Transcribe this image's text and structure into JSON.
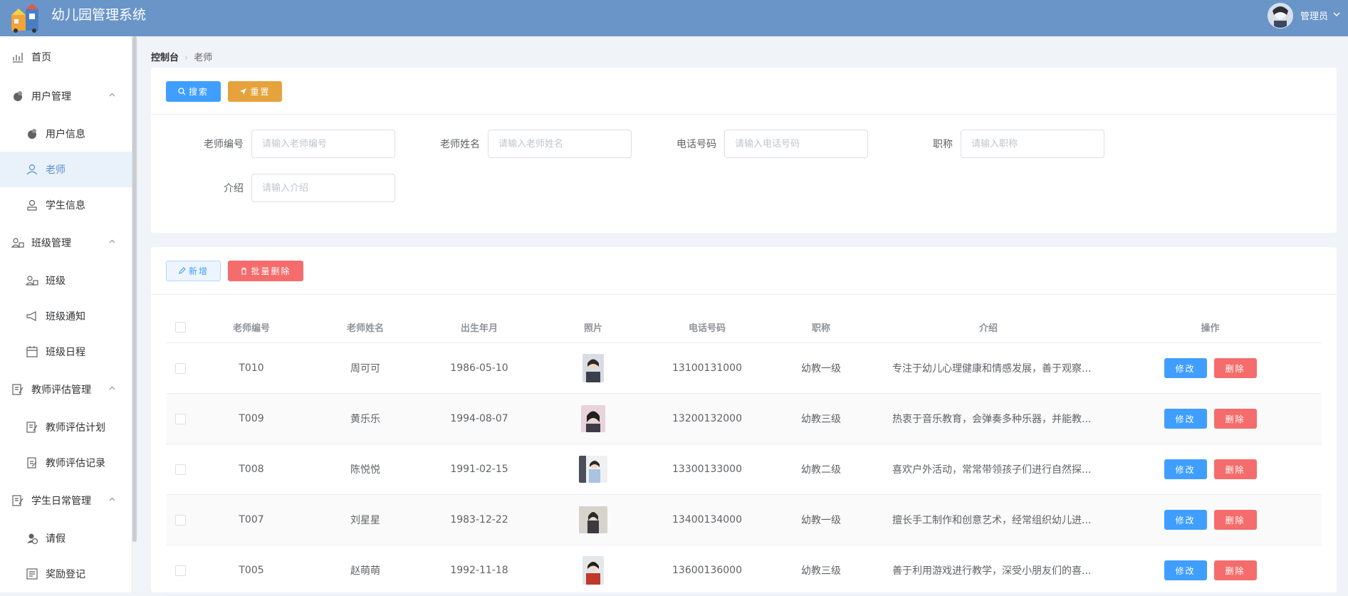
{
  "app": {
    "title": "幼儿园管理系统"
  },
  "user": {
    "name": "管理员"
  },
  "sidebar": {
    "items": [
      {
        "label": "首页",
        "icon": "chart-icon",
        "level": "top"
      },
      {
        "label": "用户管理",
        "icon": "user-group-icon",
        "level": "top",
        "expanded": true
      },
      {
        "label": "用户信息",
        "icon": "user-info-icon",
        "level": "sub"
      },
      {
        "label": "老师",
        "icon": "teacher-icon",
        "level": "sub",
        "active": true
      },
      {
        "label": "学生信息",
        "icon": "student-icon",
        "level": "sub"
      },
      {
        "label": "班级管理",
        "icon": "class-group-icon",
        "level": "top",
        "expanded": true
      },
      {
        "label": "班级",
        "icon": "class-icon",
        "level": "sub"
      },
      {
        "label": "班级通知",
        "icon": "megaphone-icon",
        "level": "sub"
      },
      {
        "label": "班级日程",
        "icon": "calendar-icon",
        "level": "sub"
      },
      {
        "label": "教师评估管理",
        "icon": "evaluation-icon",
        "level": "top",
        "expanded": true
      },
      {
        "label": "教师评估计划",
        "icon": "plan-icon",
        "level": "sub"
      },
      {
        "label": "教师评估记录",
        "icon": "record-icon",
        "level": "sub"
      },
      {
        "label": "学生日常管理",
        "icon": "daily-icon",
        "level": "top",
        "expanded": true
      },
      {
        "label": "请假",
        "icon": "leave-icon",
        "level": "sub"
      },
      {
        "label": "奖励登记",
        "icon": "reward-icon",
        "level": "sub"
      }
    ]
  },
  "breadcrumb": {
    "root": "控制台",
    "current": "老师"
  },
  "search": {
    "search_label": "搜索",
    "reset_label": "重置",
    "fields": [
      {
        "label": "老师编号",
        "placeholder": "请输入老师编号"
      },
      {
        "label": "老师姓名",
        "placeholder": "请输入老师姓名"
      },
      {
        "label": "电话号码",
        "placeholder": "请输入电话号码"
      },
      {
        "label": "职称",
        "placeholder": "请输入职称"
      },
      {
        "label": "介绍",
        "placeholder": "请输入介绍"
      }
    ]
  },
  "toolbar": {
    "add_label": "新增",
    "batch_delete_label": "批量删除"
  },
  "table": {
    "columns": [
      "老师编号",
      "老师姓名",
      "出生年月",
      "照片",
      "电话号码",
      "职称",
      "介绍",
      "操作"
    ],
    "edit_label": "修改",
    "delete_label": "删除",
    "rows": [
      {
        "no": "T010",
        "name": "周可可",
        "birth": "1986-05-10",
        "phone": "13100131000",
        "title": "幼教一级",
        "intro": "专注于幼儿心理健康和情感发展，善于观察..."
      },
      {
        "no": "T009",
        "name": "黄乐乐",
        "birth": "1994-08-07",
        "phone": "13200132000",
        "title": "幼教三级",
        "intro": "热衷于音乐教育，会弹奏多种乐器，并能教..."
      },
      {
        "no": "T008",
        "name": "陈悦悦",
        "birth": "1991-02-15",
        "phone": "13300133000",
        "title": "幼教二级",
        "intro": "喜欢户外活动，常常带领孩子们进行自然探..."
      },
      {
        "no": "T007",
        "name": "刘星星",
        "birth": "1983-12-22",
        "phone": "13400134000",
        "title": "幼教一级",
        "intro": "擅长手工制作和创意艺术，经常组织幼儿进..."
      },
      {
        "no": "T005",
        "name": "赵萌萌",
        "birth": "1992-11-18",
        "phone": "13600136000",
        "title": "幼教三级",
        "intro": "善于利用游戏进行教学，深受小朋友们的喜..."
      }
    ]
  },
  "colors": {
    "header": "#6a95c9",
    "primary": "#409eff",
    "warning": "#e6a23c",
    "danger": "#f56c6c",
    "active": "#5a8fcf"
  }
}
